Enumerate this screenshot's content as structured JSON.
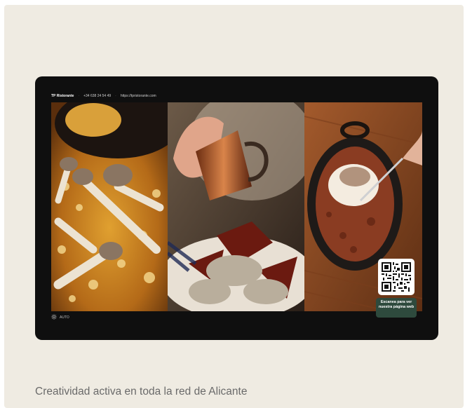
{
  "topbar": {
    "brand": "TP Ristorante",
    "separator": "·",
    "phone": "+34 638 24 54 49",
    "url": "https://tpristorante.com"
  },
  "bottombar": {
    "mode_icon": "sun-icon",
    "mode_label": "AUTO"
  },
  "panels": [
    {
      "description_icon": "food-photo-mushroom-rice"
    },
    {
      "description_icon": "food-photo-pouring-sauce"
    },
    {
      "description_icon": "food-photo-dessert-skillet"
    }
  ],
  "qr": {
    "label": "Escanea para ver nuestra página web"
  },
  "caption": "Creatividad activa en toda la red de Alicante",
  "colors": {
    "card_bg": "#efebe2",
    "screen_bg": "#0f0f0f",
    "qr_label_bg": "#2e4a3d"
  }
}
